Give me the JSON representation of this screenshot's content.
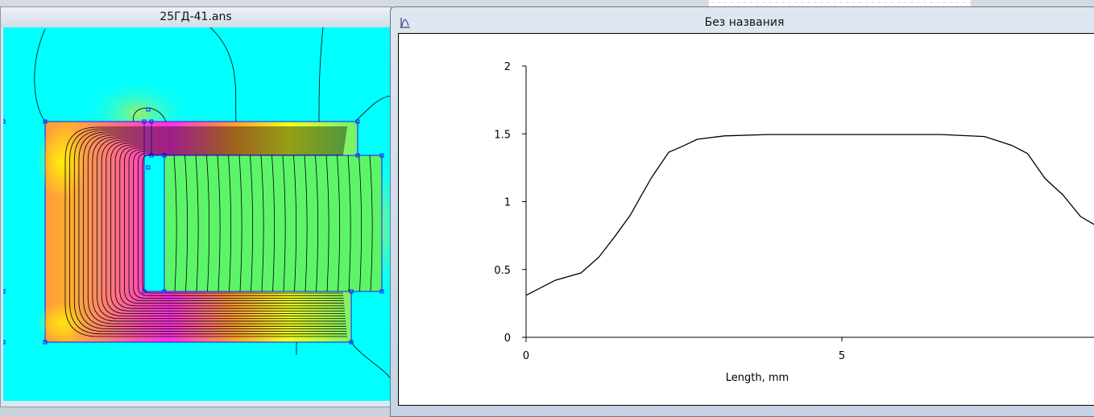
{
  "left_window": {
    "title": "25ГД-41.ans",
    "icon": "field-plot"
  },
  "right_window": {
    "title": "Без названия",
    "icon": "chart-plot-icon"
  },
  "colors": {
    "air": "#00ffff",
    "magnet": "#5cf56a",
    "high": "#ff00ff",
    "mid": "#ff8040",
    "low": "#ffff00",
    "outline": "#1a1aff"
  },
  "chart_data": {
    "type": "line",
    "title": "",
    "xlabel": "Length, mm",
    "ylabel": "",
    "xlim": [
      0,
      9
    ],
    "ylim": [
      0,
      2
    ],
    "xticks": [
      "0",
      "5"
    ],
    "yticks": [
      "0",
      "0.5",
      "1",
      "1.5",
      "2"
    ],
    "grid": false,
    "series": [
      {
        "x": [
          0,
          0.46,
          0.87,
          1.15,
          1.4,
          1.65,
          1.83,
          1.99,
          2.26,
          2.46,
          2.71,
          3.14,
          3.83,
          6.57,
          7.26,
          7.69,
          7.94,
          8.22,
          8.5,
          8.78,
          9.0
        ],
        "y": [
          0.31,
          0.42,
          0.475,
          0.59,
          0.74,
          0.9,
          1.05,
          1.18,
          1.365,
          1.405,
          1.46,
          1.485,
          1.495,
          1.495,
          1.48,
          1.415,
          1.355,
          1.17,
          1.05,
          0.89,
          0.83
        ]
      }
    ]
  }
}
